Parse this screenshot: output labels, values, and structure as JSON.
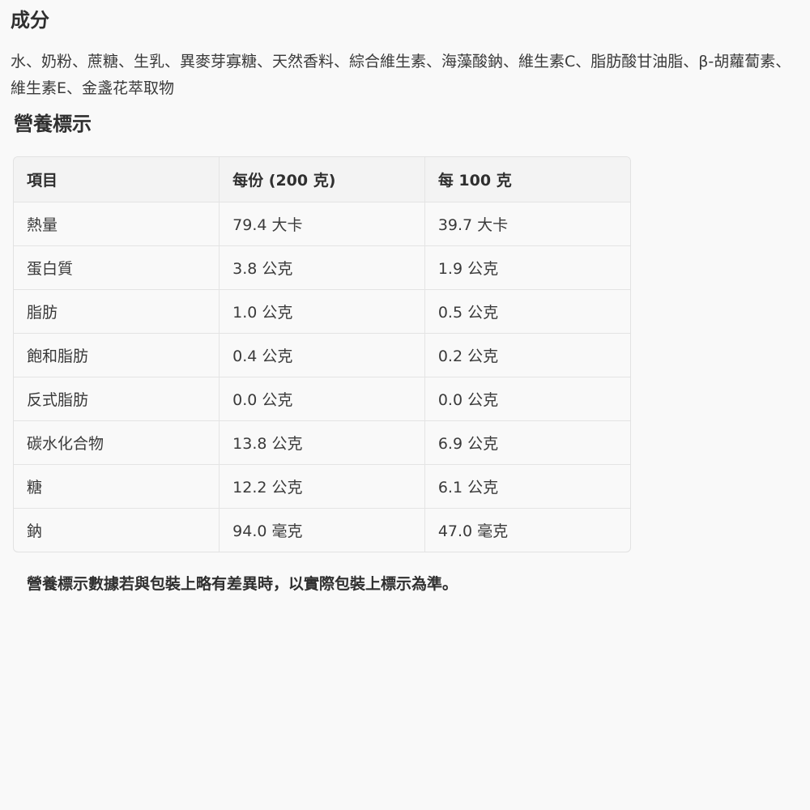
{
  "ingredients": {
    "heading": "成分",
    "text": "水、奶粉、蔗糖、生乳、異麥芽寡糖、天然香料、綜合維生素、海藻酸鈉、維生素C、脂肪酸甘油脂、β-胡蘿蔔素、維生素E、金盞花萃取物"
  },
  "nutrition": {
    "heading": "營養標示",
    "columns": [
      "項目",
      "每份 (200 克)",
      "每 100 克"
    ],
    "rows": [
      [
        "熱量",
        "79.4 大卡",
        "39.7 大卡"
      ],
      [
        "蛋白質",
        "3.8 公克",
        "1.9 公克"
      ],
      [
        "脂肪",
        "1.0 公克",
        "0.5 公克"
      ],
      [
        "飽和脂肪",
        "0.4 公克",
        "0.2 公克"
      ],
      [
        "反式脂肪",
        "0.0 公克",
        "0.0 公克"
      ],
      [
        "碳水化合物",
        "13.8 公克",
        "6.9 公克"
      ],
      [
        "糖",
        "12.2 公克",
        "6.1 公克"
      ],
      [
        "鈉",
        "94.0 毫克",
        "47.0 毫克"
      ]
    ],
    "note": "營養標示數據若與包裝上略有差異時，以實際包裝上標示為準。"
  }
}
